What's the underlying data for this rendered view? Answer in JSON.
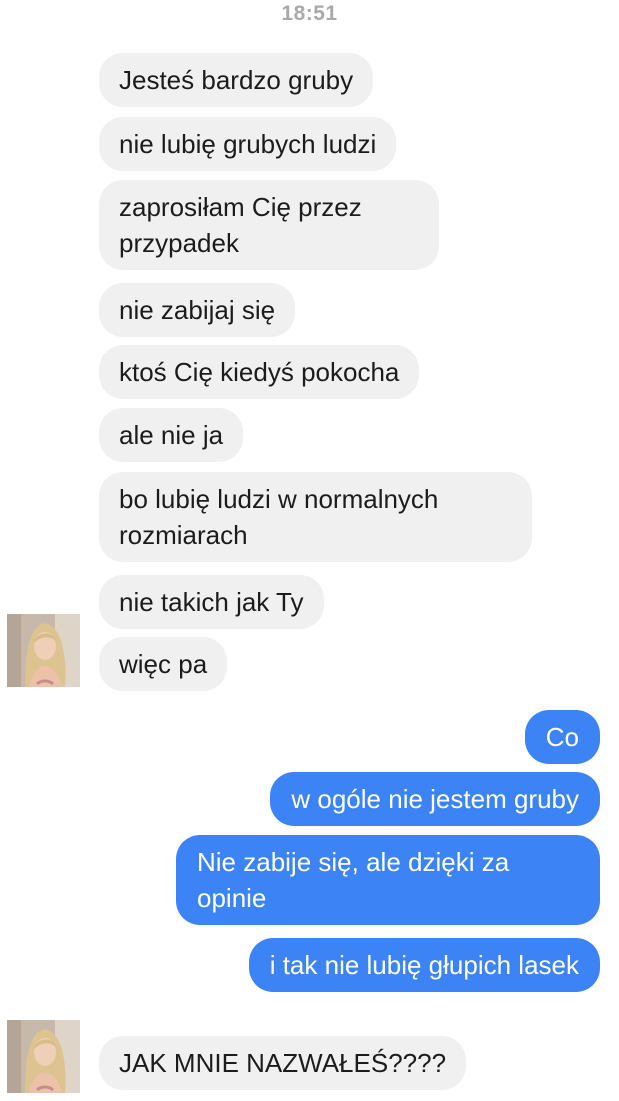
{
  "timestamp": "18:51",
  "incoming_messages": [
    "Jesteś bardzo gruby",
    "nie lubię grubych ludzi",
    "zaprosiłam Cię przez\nprzypadek",
    "nie zabijaj się",
    "ktoś Cię kiedyś pokocha",
    "ale nie ja",
    "bo lubię ludzi w normalnych\nrozmiarach",
    "nie takich jak Ty",
    "więc pa"
  ],
  "outgoing_messages": [
    "Co",
    "w ogóle nie jestem gruby",
    "Nie zabije się, ale dzięki za\nopinie",
    "i tak nie lubię głupich lasek"
  ],
  "last_incoming_message": "JAK MNIE NAZWAŁEŚ????",
  "colors": {
    "incoming_bubble": "#f0f0f0",
    "outgoing_bubble": "#3c83f6",
    "timestamp": "#a9a9a9"
  },
  "avatar_icon": "contact-photo-icon"
}
